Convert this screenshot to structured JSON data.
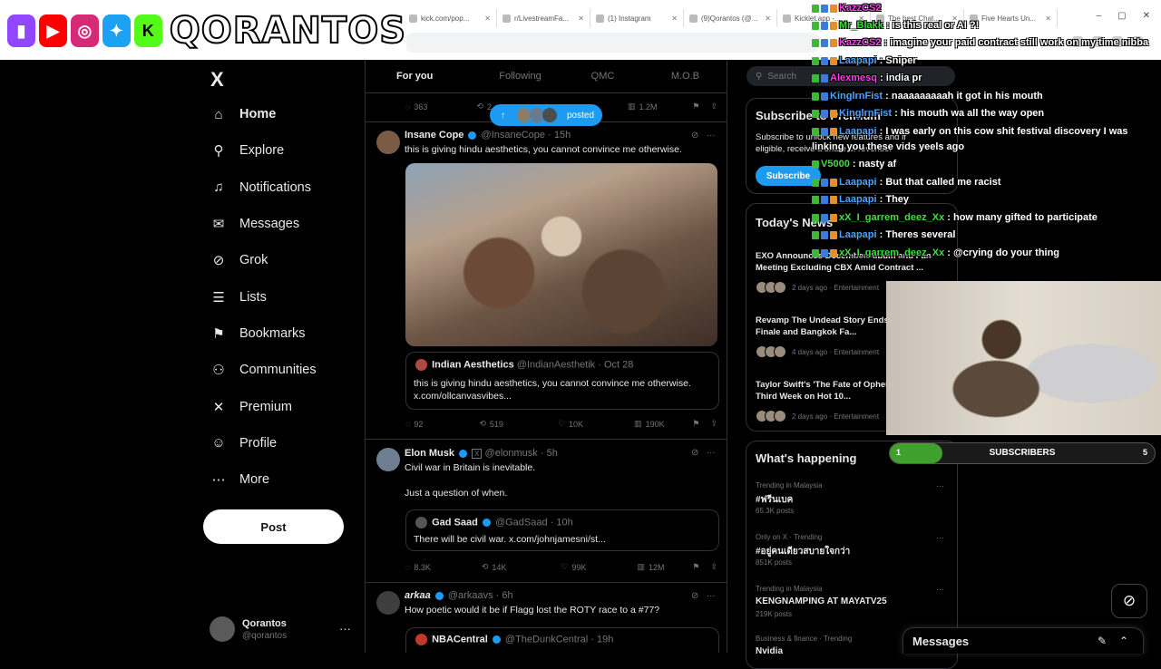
{
  "browser": {
    "tabs": [
      {
        "label": "kick.com/pop...",
        "icon": "kick-icon"
      },
      {
        "label": "r/LivestreamFa...",
        "icon": "reddit-icon"
      },
      {
        "label": "(1) Instagram",
        "icon": "instagram-icon"
      },
      {
        "label": "(9)Qorantos (@...",
        "icon": "tiktok-icon"
      },
      {
        "label": "Kicklet.app -...",
        "icon": "kicklet-icon"
      },
      {
        "label": "The best Chat...",
        "icon": "chat-icon"
      },
      {
        "label": "Five Hearts Un...",
        "icon": "page-icon"
      }
    ],
    "window_controls": [
      "–",
      "▢",
      "✕"
    ]
  },
  "overlay": {
    "channel_name": "QORANTOS",
    "logos": [
      "twitch",
      "youtube",
      "instagram",
      "twitter",
      "kick"
    ]
  },
  "sidebar": {
    "logo": "X",
    "items": [
      {
        "label": "Home",
        "icon": "home-icon",
        "glyph": "⌂",
        "active": true
      },
      {
        "label": "Explore",
        "icon": "search-icon",
        "glyph": "⚲"
      },
      {
        "label": "Notifications",
        "icon": "bell-icon",
        "glyph": "♫"
      },
      {
        "label": "Messages",
        "icon": "envelope-icon",
        "glyph": "✉"
      },
      {
        "label": "Grok",
        "icon": "grok-icon",
        "glyph": "⊘"
      },
      {
        "label": "Lists",
        "icon": "list-icon",
        "glyph": "☰"
      },
      {
        "label": "Bookmarks",
        "icon": "bookmark-icon",
        "glyph": "⚑"
      },
      {
        "label": "Communities",
        "icon": "people-icon",
        "glyph": "⚇"
      },
      {
        "label": "Premium",
        "icon": "x-icon",
        "glyph": "✕"
      },
      {
        "label": "Profile",
        "icon": "person-icon",
        "glyph": "☺"
      },
      {
        "label": "More",
        "icon": "more-circle-icon",
        "glyph": "⋯"
      }
    ],
    "post_label": "Post",
    "account": {
      "name": "Qorantos",
      "handle": "@qorantos",
      "menu": "···"
    }
  },
  "timeline": {
    "tabs": [
      "For you",
      "Following",
      "QMC",
      "M.O.B"
    ],
    "posted_pill": "posted",
    "top_actions": {
      "replies": "363",
      "reposts": "2",
      "views": "1.2M"
    },
    "tweets": [
      {
        "name": "Insane Cope",
        "handle": "@InsaneCope",
        "time": "15h",
        "text": "this is giving hindu aesthetics, you cannot convince me otherwise.",
        "quote": {
          "name": "Indian Aesthetics",
          "handle": "@IndianAesthetik",
          "time": "Oct 28",
          "text1": "this is giving hindu aesthetics, you cannot convince me otherwise.",
          "text2": "x.com/ollcanvasvibes..."
        },
        "replies": "92",
        "reposts": "519",
        "likes": "10K",
        "views": "190K"
      },
      {
        "name": "Elon Musk",
        "handle": "@elonmusk",
        "time": "5h",
        "text1": "Civil war in Britain is inevitable.",
        "text2": "Just a question of when.",
        "quote": {
          "name": "Gad Saad",
          "handle": "@GadSaad",
          "time": "10h",
          "text": "There will be civil war. x.com/johnjamesni/st..."
        },
        "replies": "8.3K",
        "reposts": "14K",
        "likes": "99K",
        "views": "12M"
      },
      {
        "name": "arkaa",
        "handle": "@arkaavs",
        "time": "6h",
        "text": "How poetic would it be if Flagg lost the ROTY race to a #77?",
        "quote": {
          "name": "NBACentral",
          "handle": "@TheDunkCentral",
          "time": "19h"
        }
      }
    ]
  },
  "right": {
    "search_placeholder": "Search",
    "premium": {
      "title": "Subscribe to Premium",
      "body1": "Subscribe to unlock new features and if",
      "body2": "eligible, receive a share of revenue.",
      "button": "Subscribe"
    },
    "news": {
      "title": "Today's News",
      "items": [
        {
          "title": "EXO Announces December Album and Fan Meeting Excluding CBX Amid Contract ...",
          "meta": "2 days ago · Entertainment"
        },
        {
          "title": "Revamp The Undead Story Ends with Thrilling Finale and Bangkok Fa...",
          "meta": "4 days ago · Entertainment"
        },
        {
          "title": "Taylor Swift's 'The Fate of Ophelia' No. 1 for Third Week on Hot 10...",
          "meta": "2 days ago · Entertainment"
        }
      ]
    },
    "happening": {
      "title": "What's happening",
      "items": [
        {
          "cat": "Trending in Malaysia",
          "name": "#ฟรีนเบค",
          "count": "65.3K posts"
        },
        {
          "cat": "Only on X · Trending",
          "name": "#อยู่คนเดียวสบายใจกว่า",
          "count": "851K posts"
        },
        {
          "cat": "Trending in Malaysia",
          "name": "KENGNAMPING AT MAYATV25",
          "count": "219K posts"
        },
        {
          "cat": "Business & finance · Trending",
          "name": "Nvidia",
          "count": ""
        }
      ]
    }
  },
  "chat": [
    {
      "user": "KazzCS2",
      "msg": "",
      "color": "#ff3df2",
      "badges": [
        "b-green",
        "b-blue",
        "b-orange"
      ]
    },
    {
      "user": "Mr_Blakk",
      "msg": "is this real or AI ?!",
      "color": "#3ee03e",
      "badges": [
        "b-green",
        "b-blue",
        "b-orange"
      ]
    },
    {
      "user": "KazzCS2",
      "msg": "imagine your paid contract still work on my time nibba",
      "color": "#ff3df2",
      "badges": [
        "b-green",
        "b-blue",
        "b-orange"
      ]
    },
    {
      "user": "Laapapi",
      "msg": "Sniper",
      "color": "#4aa3ff",
      "badges": [
        "b-green",
        "b-blue",
        "b-orange"
      ]
    },
    {
      "user": "Alexmesq",
      "msg": "india pr",
      "color": "#ff3df2",
      "badges": [
        "b-green",
        "b-blue"
      ]
    },
    {
      "user": "KinglrnFist",
      "msg": "naaaaaaaaah it got in his mouth",
      "color": "#4aa3ff",
      "badges": [
        "b-green",
        "b-blue"
      ]
    },
    {
      "user": "KinglrnFist",
      "msg": "his mouth wa all the way open",
      "color": "#4aa3ff",
      "badges": [
        "b-green",
        "b-blue",
        "b-orange"
      ]
    },
    {
      "user": "Laapapi",
      "msg": "I was early on this cow shit festival discovery I was",
      "color": "#4aa3ff",
      "badges": [
        "b-green",
        "b-blue",
        "b-orange"
      ]
    },
    {
      "user": "",
      "msg": "linking you these vids yeels ago",
      "color": "#ffffff",
      "badges": []
    },
    {
      "user": "V5000",
      "msg": "nasty af",
      "color": "#3ee03e",
      "badges": [
        "b-green"
      ]
    },
    {
      "user": "Laapapi",
      "msg": "But that called me racist",
      "color": "#4aa3ff",
      "badges": [
        "b-green",
        "b-blue",
        "b-orange"
      ]
    },
    {
      "user": "Laapapi",
      "msg": "They",
      "color": "#4aa3ff",
      "badges": [
        "b-green",
        "b-blue",
        "b-orange"
      ]
    },
    {
      "user": "xX_I_garrem_deez_Xx",
      "msg": "how many gifted to participate",
      "color": "#3ee03e",
      "badges": [
        "b-green",
        "b-blue",
        "b-orange"
      ]
    },
    {
      "user": "Laapapi",
      "msg": "Theres several",
      "color": "#4aa3ff",
      "badges": [
        "b-green",
        "b-blue",
        "b-orange"
      ]
    },
    {
      "user": "xX_I_garrem_deez_Xx",
      "msg": "@crying do your thing",
      "color": "#3ee03e",
      "badges": [
        "b-green",
        "b-blue",
        "b-orange"
      ]
    }
  ],
  "subscribers": {
    "label": "SUBSCRIBERS",
    "current": "1",
    "goal": "5",
    "progress": 0.2
  },
  "messages_dock": {
    "title": "Messages"
  }
}
